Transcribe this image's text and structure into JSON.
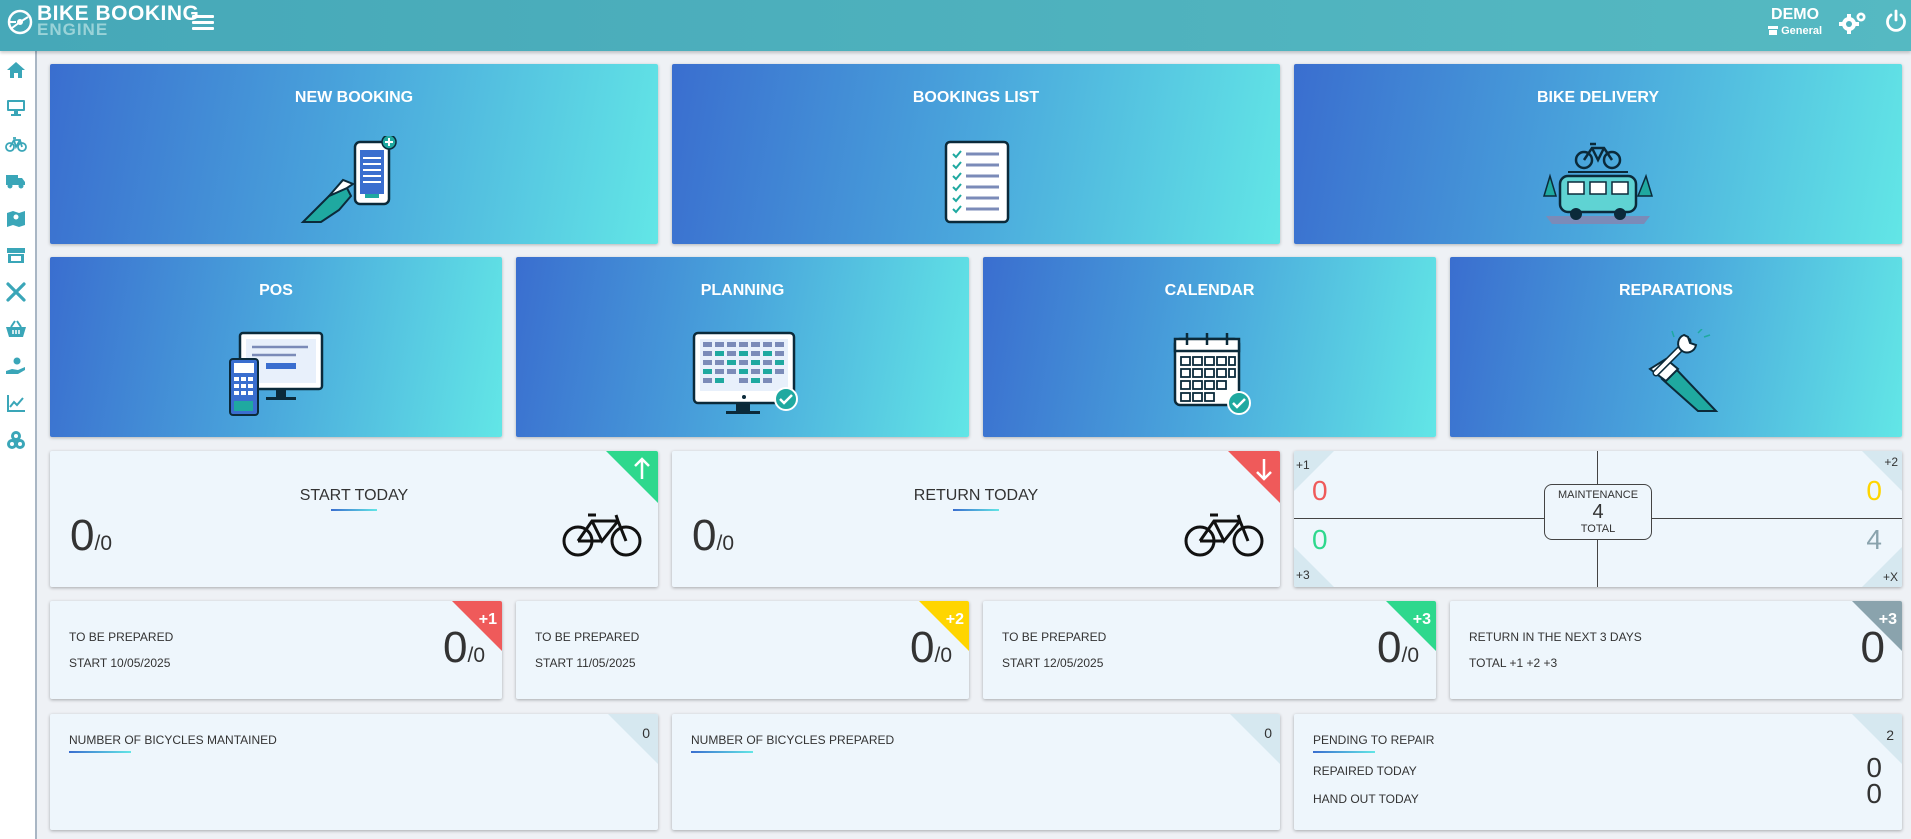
{
  "header": {
    "logo_line1": "BIKE BOOKING",
    "logo_line2": "ENGINE",
    "user_name": "DEMO",
    "shop_name": "General"
  },
  "sidebar": {
    "items": [
      {
        "icon": "home-icon"
      },
      {
        "icon": "monitor-icon"
      },
      {
        "icon": "bicycle-icon"
      },
      {
        "icon": "truck-icon"
      },
      {
        "icon": "map-icon"
      },
      {
        "icon": "store-icon"
      },
      {
        "icon": "tools-icon"
      },
      {
        "icon": "basket-icon"
      },
      {
        "icon": "hand-coin-icon"
      },
      {
        "icon": "chart-line-icon"
      },
      {
        "icon": "boxes-icon"
      }
    ]
  },
  "tiles": {
    "new_booking": "NEW BOOKING",
    "bookings_list": "BOOKINGS LIST",
    "bike_delivery": "BIKE DELIVERY",
    "pos": "POS",
    "planning": "PLANNING",
    "calendar": "CALENDAR",
    "reparations": "REPARATIONS"
  },
  "start_today": {
    "title": "START TODAY",
    "value": "0",
    "total": "/0"
  },
  "return_today": {
    "title": "RETURN TODAY",
    "value": "0",
    "total": "/0"
  },
  "maintenance": {
    "title": "MAINTENANCE",
    "total_value": "4",
    "total_label": "TOTAL",
    "tl_badge": "+1",
    "tr_badge": "+2",
    "bl_badge": "+3",
    "br_badge": "+X",
    "tl_value": "0",
    "tr_value": "0",
    "bl_value": "0",
    "br_value": "4"
  },
  "prepare_cards": [
    {
      "label": "TO BE PREPARED",
      "sub": "START 10/05/2025",
      "value": "0",
      "total": "/0",
      "badge": "+1"
    },
    {
      "label": "TO BE PREPARED",
      "sub": "START 11/05/2025",
      "value": "0",
      "total": "/0",
      "badge": "+2"
    },
    {
      "label": "TO BE PREPARED",
      "sub": "START 12/05/2025",
      "value": "0",
      "total": "/0",
      "badge": "+3"
    }
  ],
  "return_next": {
    "label": "RETURN IN THE NEXT 3 DAYS",
    "sub": "TOTAL +1 +2 +3",
    "value": "0",
    "badge": "+3"
  },
  "maintained": {
    "label": "NUMBER OF BICYCLES MANTAINED",
    "count": "0"
  },
  "prepared": {
    "label": "NUMBER OF BICYCLES PREPARED",
    "count": "0"
  },
  "repair": {
    "label": "PENDING TO REPAIR",
    "count": "2",
    "repaired_label": "REPAIRED TODAY",
    "repaired_value": "0",
    "handout_label": "HAND OUT TODAY",
    "handout_value": "0"
  },
  "colors": {
    "topbar": "#4fb2be",
    "tile_start": "#3a6ecf",
    "tile_end": "#62e6e6",
    "red": "#ef5a5a",
    "yellow": "#ffd500",
    "green": "#2ed88d",
    "gray": "#8aa3ad"
  }
}
